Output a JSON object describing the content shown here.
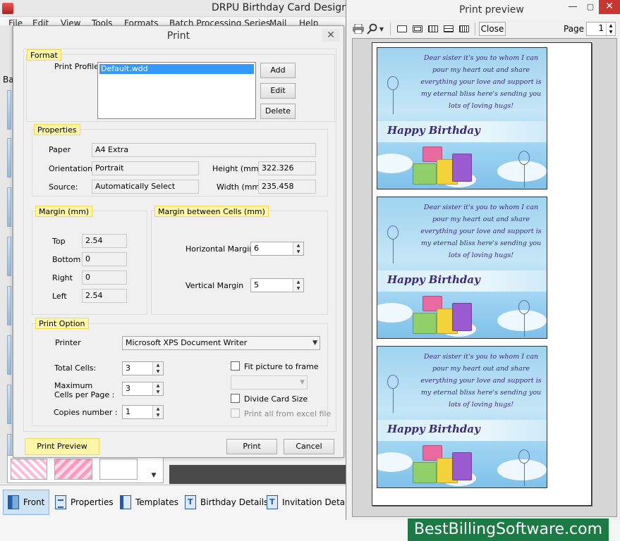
{
  "app": {
    "title": "DRPU Birthday Card Design",
    "menu": [
      "File",
      "Edit",
      "View",
      "Tools",
      "Formats",
      "Batch Processing Series",
      "Mail",
      "Help"
    ],
    "side_label": "Ba",
    "tabs": [
      {
        "label": "Front",
        "icon": "book-icon",
        "active": true
      },
      {
        "label": "Properties",
        "icon": "document-icon"
      },
      {
        "label": "Templates",
        "icon": "templates-icon"
      },
      {
        "label": "Birthday Details",
        "icon": "text-icon"
      },
      {
        "label": "Invitation Details",
        "icon": "text-icon"
      }
    ]
  },
  "dialog": {
    "title": "Print",
    "close_glyph": "✕",
    "format": {
      "legend": "Format",
      "profile_label": "Print Profile",
      "profiles": [
        "Default.wdd"
      ],
      "add": "Add",
      "edit": "Edit",
      "delete": "Delete"
    },
    "properties": {
      "legend": "Properties",
      "paper_label": "Paper",
      "paper_value": "A4 Extra",
      "orientation_label": "Orientation",
      "orientation_value": "Portrait",
      "source_label": "Source:",
      "source_value": "Automatically Select",
      "height_label": "Height (mm)",
      "height_value": "322.326",
      "width_label": "Width (mm)",
      "width_value": "235.458"
    },
    "margin": {
      "legend": "Margin (mm)",
      "top_label": "Top",
      "top_value": "2.54",
      "bottom_label": "Bottom",
      "bottom_value": "0",
      "right_label": "Right",
      "right_value": "0",
      "left_label": "Left",
      "left_value": "2.54"
    },
    "cell_margin": {
      "legend": "Margin between Cells (mm)",
      "horizontal_label": "Horizontal Margin",
      "horizontal_value": "6",
      "vertical_label": "Vertical Margin",
      "vertical_value": "5"
    },
    "print_option": {
      "legend": "Print Option",
      "printer_label": "Printer",
      "printer_value": "Microsoft XPS Document Writer",
      "total_cells_label": "Total Cells:",
      "total_cells_value": "3",
      "max_cells_label_1": "Maximum",
      "max_cells_label_2": "Cells per Page :",
      "max_cells_value": "3",
      "copies_label": "Copies number :",
      "copies_value": "1",
      "fit_picture": "Fit picture to frame",
      "fit_picture_checked": false,
      "divide_card": "Divide Card Size",
      "divide_card_checked": false,
      "print_excel": "Print all from excel file",
      "print_excel_checked": false
    },
    "buttons": {
      "preview": "Print Preview",
      "print": "Print",
      "cancel": "Cancel"
    }
  },
  "preview": {
    "title": "Print preview",
    "close_button": "Close",
    "page_label": "Page",
    "page_value": "1",
    "card": {
      "message_lines": [
        "Dear sister it's you to whom I can",
        "pour my heart out and share",
        "everything your love and support is",
        "my eternal bliss here's sending you",
        "lots of loving hugs!"
      ],
      "title": "Happy Birthday"
    }
  },
  "brand": "BestBillingSoftware.com",
  "colors": {
    "legend_bg": "#fdf5a8",
    "selection": "#3399ff",
    "close_red": "#c7372f",
    "brand_green": "#1c7a45",
    "card_text": "#3a2a7a"
  }
}
